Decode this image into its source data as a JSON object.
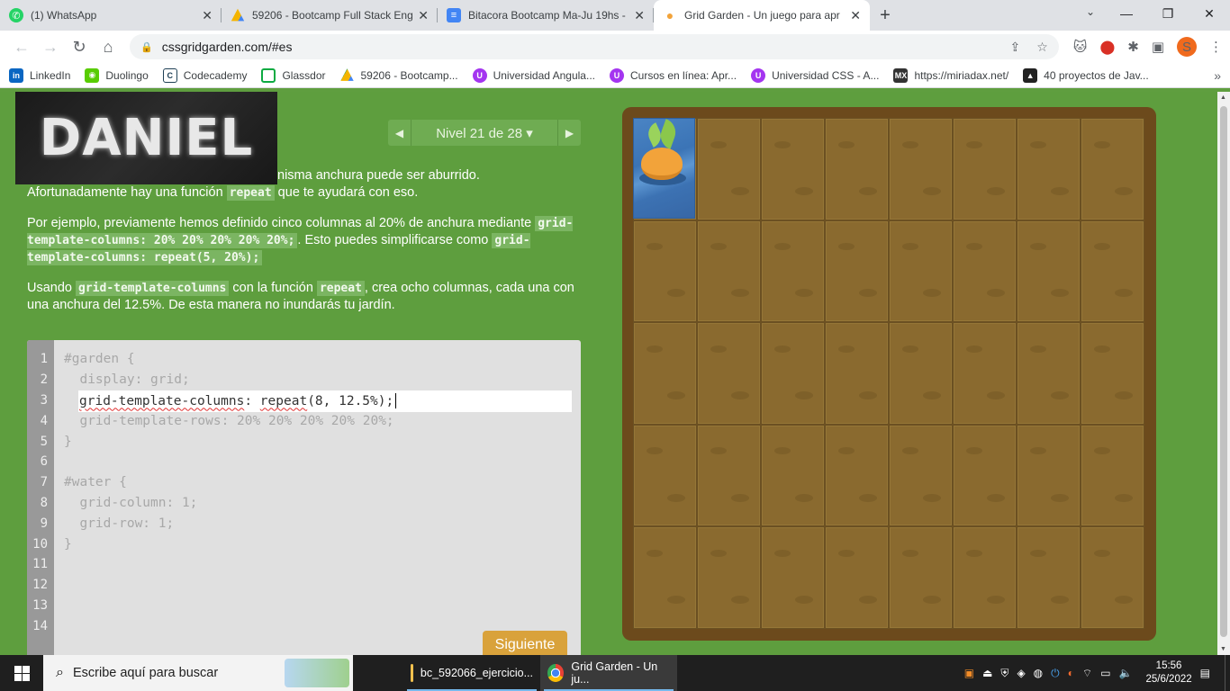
{
  "browser": {
    "tabs": [
      {
        "title": "(1) WhatsApp",
        "icon": "whatsapp-icon",
        "color": "#25d366"
      },
      {
        "title": "59206 - Bootcamp Full Stack Eng",
        "icon": "google-drive-icon",
        "color": "#f4b400"
      },
      {
        "title": "Bitacora Bootcamp Ma-Ju 19hs -",
        "icon": "google-docs-icon",
        "color": "#4285f4"
      },
      {
        "title": "Grid Garden - Un juego para apr",
        "icon": "carrot-icon",
        "color": "#f2a33a"
      }
    ],
    "url": "cssgridgarden.com/#es",
    "bookmarks": [
      {
        "label": "LinkedIn",
        "icon": "linkedin-icon",
        "color": "#0a66c2"
      },
      {
        "label": "Duolingo",
        "icon": "duolingo-icon",
        "color": "#58cc02"
      },
      {
        "label": "Codecademy",
        "icon": "codecademy-icon",
        "color": "#1f4056"
      },
      {
        "label": "Glassdor",
        "icon": "glassdoor-icon",
        "color": "#0caa41"
      },
      {
        "label": "59206 - Bootcamp...",
        "icon": "google-drive-icon",
        "color": "#f4b400"
      },
      {
        "label": "Universidad Angula...",
        "icon": "udemy-icon",
        "color": "#a435f0"
      },
      {
        "label": "Cursos en línea: Apr...",
        "icon": "udemy-icon",
        "color": "#a435f0"
      },
      {
        "label": "Universidad CSS - A...",
        "icon": "udemy-icon",
        "color": "#a435f0"
      },
      {
        "label": "https://miriadax.net/",
        "icon": "miriadax-icon",
        "color": "#333333"
      },
      {
        "label": "40 proyectos de Jav...",
        "icon": "javascript-icon",
        "color": "#222222"
      }
    ],
    "profile_initial": "S"
  },
  "overlay": {
    "text": "DANIEL"
  },
  "level_nav": {
    "label": "Nivel 21 de 28 ▾"
  },
  "instructions": {
    "p1_pre": "nisma anchura puede ser aburrido. Afortunadamente hay una función ",
    "p1_code": "repeat",
    "p1_post": " que te ayudará con eso.",
    "p2_pre": "Por ejemplo, previamente hemos definido cinco columnas al 20% de anchura mediante ",
    "p2_code1": "grid-template-columns: 20% 20% 20% 20% 20%;",
    "p2_mid": ". Esto puedes simplificarse como ",
    "p2_code2": "grid-template-columns: repeat(5, 20%);",
    "p3_pre": "Usando ",
    "p3_code1": "grid-template-columns",
    "p3_mid": " con la función ",
    "p3_code2": "repeat",
    "p3_post": ", crea ocho columnas, cada una con una anchura del 12.5%. De esta manera no inundarás tu jardín."
  },
  "editor": {
    "line_numbers": [
      "1",
      "2",
      "3",
      "4",
      "5",
      "6",
      "7",
      "8",
      "9",
      "10",
      "11",
      "12",
      "13",
      "14"
    ],
    "lines": [
      "#garden {",
      "  display: grid;",
      "",
      "  grid-template-rows: 20% 20% 20% 20% 20%;",
      "}",
      "",
      "#water {",
      "  grid-column: 1;",
      "  grid-row: 1;",
      "}",
      "",
      "",
      "",
      ""
    ],
    "input_prop": "grid-template-columns",
    "input_colon": ": ",
    "input_func": "repeat",
    "input_args": "(8, 12.5%);",
    "next_label": "Siguiente"
  },
  "garden": {
    "columns": 8,
    "rows": 5
  },
  "taskbar": {
    "search_placeholder": "Escribe aquí para buscar",
    "apps": [
      {
        "label": "bc_592066_ejercicio...",
        "icon": "folder-icon",
        "color": "#f2c14e"
      },
      {
        "label": "Grid Garden - Un ju...",
        "icon": "chrome-icon",
        "color": "#e94235"
      }
    ],
    "time": "15:56",
    "date": "25/6/2022"
  }
}
